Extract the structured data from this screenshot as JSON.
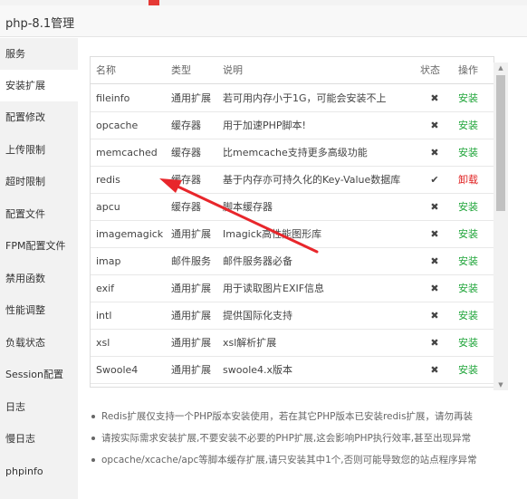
{
  "dialog": {
    "title": "php-8.1管理"
  },
  "sidebar": {
    "items": [
      {
        "label": "服务"
      },
      {
        "label": "安装扩展"
      },
      {
        "label": "配置修改"
      },
      {
        "label": "上传限制"
      },
      {
        "label": "超时限制"
      },
      {
        "label": "配置文件"
      },
      {
        "label": "FPM配置文件"
      },
      {
        "label": "禁用函数"
      },
      {
        "label": "性能调整"
      },
      {
        "label": "负载状态"
      },
      {
        "label": "Session配置"
      },
      {
        "label": "日志"
      },
      {
        "label": "慢日志"
      },
      {
        "label": "phpinfo"
      }
    ],
    "active_index": 1
  },
  "table": {
    "headers": {
      "name": "名称",
      "type": "类型",
      "desc": "说明",
      "status": "状态",
      "op": "操作"
    },
    "rows": [
      {
        "name": "fileinfo",
        "type": "通用扩展",
        "desc": "若可用内存小于1G，可能会安装不上",
        "status": "✖",
        "op": "安装",
        "installed": false
      },
      {
        "name": "opcache",
        "type": "缓存器",
        "desc": "用于加速PHP脚本!",
        "status": "✖",
        "op": "安装",
        "installed": false
      },
      {
        "name": "memcached",
        "type": "缓存器",
        "desc": "比memcache支持更多高级功能",
        "status": "✖",
        "op": "安装",
        "installed": false
      },
      {
        "name": "redis",
        "type": "缓存器",
        "desc": "基于内存亦可持久化的Key-Value数据库",
        "status": "✔",
        "op": "卸载",
        "installed": true
      },
      {
        "name": "apcu",
        "type": "缓存器",
        "desc": "脚本缓存器",
        "status": "✖",
        "op": "安装",
        "installed": false
      },
      {
        "name": "imagemagick",
        "type": "通用扩展",
        "desc": "Imagick高性能图形库",
        "status": "✖",
        "op": "安装",
        "installed": false
      },
      {
        "name": "imap",
        "type": "邮件服务",
        "desc": "邮件服务器必备",
        "status": "✖",
        "op": "安装",
        "installed": false
      },
      {
        "name": "exif",
        "type": "通用扩展",
        "desc": "用于读取图片EXIF信息",
        "status": "✖",
        "op": "安装",
        "installed": false
      },
      {
        "name": "intl",
        "type": "通用扩展",
        "desc": "提供国际化支持",
        "status": "✖",
        "op": "安装",
        "installed": false
      },
      {
        "name": "xsl",
        "type": "通用扩展",
        "desc": "xsl解析扩展",
        "status": "✖",
        "op": "安装",
        "installed": false
      },
      {
        "name": "Swoole4",
        "type": "通用扩展",
        "desc": "swoole4.x版本",
        "status": "✖",
        "op": "安装",
        "installed": false
      }
    ]
  },
  "notes": [
    "Redis扩展仅支持一个PHP版本安装使用，若在其它PHP版本已安装redis扩展，请勿再装",
    "请按实际需求安装扩展,不要安装不必要的PHP扩展,这会影响PHP执行效率,甚至出现异常",
    "opcache/xcache/apc等脚本缓存扩展,请只安装其中1个,否则可能导致您的站点程序异常"
  ],
  "colors": {
    "install": "#20a53a",
    "uninstall": "#e02020",
    "annotation_arrow": "#e8262b"
  },
  "icons": {
    "not_installed": "cross-icon",
    "installed": "check-icon"
  }
}
